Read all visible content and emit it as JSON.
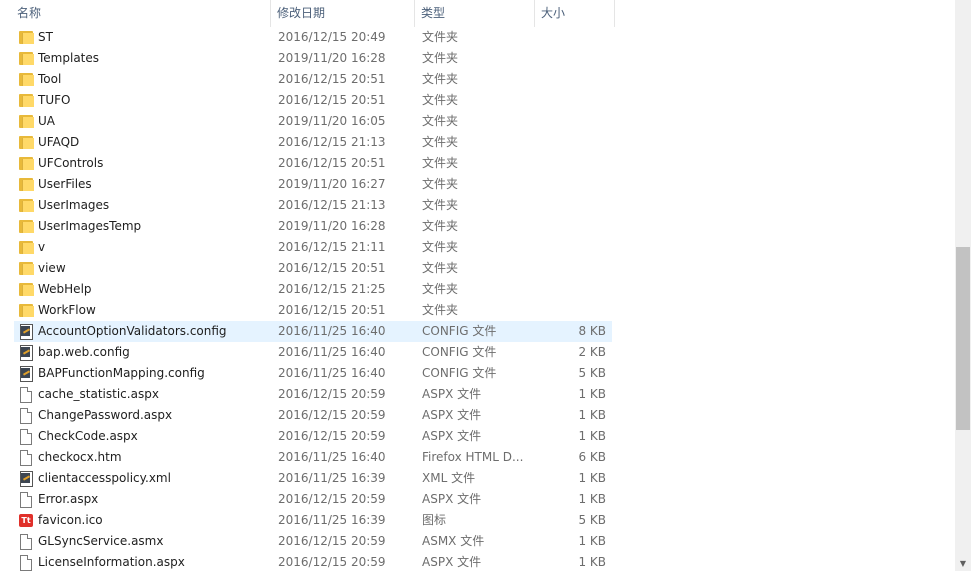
{
  "columns": {
    "name": "名称",
    "date": "修改日期",
    "type": "类型",
    "size": "大小",
    "sort_indicator": "^"
  },
  "files": [
    {
      "name": "ST",
      "date": "2016/12/15 20:49",
      "type": "文件夹",
      "size": "",
      "icon": "folder-icon"
    },
    {
      "name": "Templates",
      "date": "2019/11/20 16:28",
      "type": "文件夹",
      "size": "",
      "icon": "folder-icon"
    },
    {
      "name": "Tool",
      "date": "2016/12/15 20:51",
      "type": "文件夹",
      "size": "",
      "icon": "folder-icon"
    },
    {
      "name": "TUFO",
      "date": "2016/12/15 20:51",
      "type": "文件夹",
      "size": "",
      "icon": "folder-icon"
    },
    {
      "name": "UA",
      "date": "2019/11/20 16:05",
      "type": "文件夹",
      "size": "",
      "icon": "folder-icon"
    },
    {
      "name": "UFAQD",
      "date": "2016/12/15 21:13",
      "type": "文件夹",
      "size": "",
      "icon": "folder-icon"
    },
    {
      "name": "UFControls",
      "date": "2016/12/15 20:51",
      "type": "文件夹",
      "size": "",
      "icon": "folder-icon"
    },
    {
      "name": "UserFiles",
      "date": "2019/11/20 16:27",
      "type": "文件夹",
      "size": "",
      "icon": "folder-icon"
    },
    {
      "name": "UserImages",
      "date": "2016/12/15 21:13",
      "type": "文件夹",
      "size": "",
      "icon": "folder-icon"
    },
    {
      "name": "UserImagesTemp",
      "date": "2019/11/20 16:28",
      "type": "文件夹",
      "size": "",
      "icon": "folder-icon"
    },
    {
      "name": "v",
      "date": "2016/12/15 21:11",
      "type": "文件夹",
      "size": "",
      "icon": "folder-icon"
    },
    {
      "name": "view",
      "date": "2016/12/15 20:51",
      "type": "文件夹",
      "size": "",
      "icon": "folder-icon"
    },
    {
      "name": "WebHelp",
      "date": "2016/12/15 21:25",
      "type": "文件夹",
      "size": "",
      "icon": "folder-icon"
    },
    {
      "name": "WorkFlow",
      "date": "2016/12/15 20:51",
      "type": "文件夹",
      "size": "",
      "icon": "folder-icon"
    },
    {
      "name": "AccountOptionValidators.config",
      "date": "2016/11/25 16:40",
      "type": "CONFIG 文件",
      "size": "8 KB",
      "icon": "config-file-icon",
      "selected": true
    },
    {
      "name": "bap.web.config",
      "date": "2016/11/25 16:40",
      "type": "CONFIG 文件",
      "size": "2 KB",
      "icon": "config-file-icon"
    },
    {
      "name": "BAPFunctionMapping.config",
      "date": "2016/11/25 16:40",
      "type": "CONFIG 文件",
      "size": "5 KB",
      "icon": "config-file-icon"
    },
    {
      "name": "cache_statistic.aspx",
      "date": "2016/12/15 20:59",
      "type": "ASPX 文件",
      "size": "1 KB",
      "icon": "document-icon"
    },
    {
      "name": "ChangePassword.aspx",
      "date": "2016/12/15 20:59",
      "type": "ASPX 文件",
      "size": "1 KB",
      "icon": "document-icon"
    },
    {
      "name": "CheckCode.aspx",
      "date": "2016/12/15 20:59",
      "type": "ASPX 文件",
      "size": "1 KB",
      "icon": "document-icon"
    },
    {
      "name": "checkocx.htm",
      "date": "2016/11/25 16:40",
      "type": "Firefox HTML D...",
      "size": "6 KB",
      "icon": "document-icon"
    },
    {
      "name": "clientaccesspolicy.xml",
      "date": "2016/11/25 16:39",
      "type": "XML 文件",
      "size": "1 KB",
      "icon": "config-file-icon"
    },
    {
      "name": "Error.aspx",
      "date": "2016/12/15 20:59",
      "type": "ASPX 文件",
      "size": "1 KB",
      "icon": "document-icon"
    },
    {
      "name": "favicon.ico",
      "date": "2016/11/25 16:39",
      "type": "图标",
      "size": "5 KB",
      "icon": "favicon-icon"
    },
    {
      "name": "GLSyncService.asmx",
      "date": "2016/12/15 20:59",
      "type": "ASMX 文件",
      "size": "1 KB",
      "icon": "document-icon"
    },
    {
      "name": "LicenseInformation.aspx",
      "date": "2016/12/15 20:59",
      "type": "ASPX 文件",
      "size": "1 KB",
      "icon": "document-icon"
    }
  ]
}
